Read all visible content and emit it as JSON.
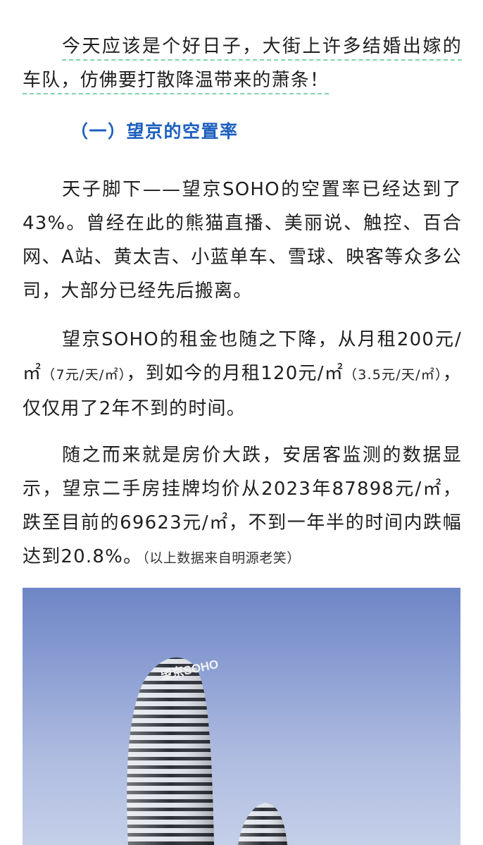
{
  "paragraphs": {
    "p1": "今天应该是个好日子，大街上许多结婚出嫁的车队，仿佛要打散降温带来的萧条！",
    "p2": "天子脚下——望京SOHO的空置率已经达到了43%。曾经在此的熊猫直播、美丽说、触控、百合网、A站、黄太吉、小蓝单车、雪球、映客等众多公司，大部分已经先后搬离。",
    "p3_a": "望京SOHO的租金也随之下降，从月租200元/㎡",
    "p3_b": "（7元/天/㎡）",
    "p3_c": "，到如今的月租120元/㎡",
    "p3_d": "（3.5元/天/㎡）",
    "p3_e": "，仅仅用了2年不到的时间。",
    "p4_a": "随之而来就是房价大跌，安居客监测的数据显示，望京二手房挂牌均价从2023年87898元/㎡，跌至目前的69623元/㎡，不到一年半的时间内跌幅达到20.8%。",
    "p4_b": "（以上数据来自明源老笑）"
  },
  "section_heading": "（一）望京的空置率",
  "photo": {
    "sign_text": "望京SOHO"
  },
  "colors": {
    "heading": "#1d5fbd",
    "highlight_underline": "#7fd3ad",
    "text": "#1f1f1f",
    "sky_top": "#6e86c6",
    "sky_bottom": "#c4cfe8"
  }
}
